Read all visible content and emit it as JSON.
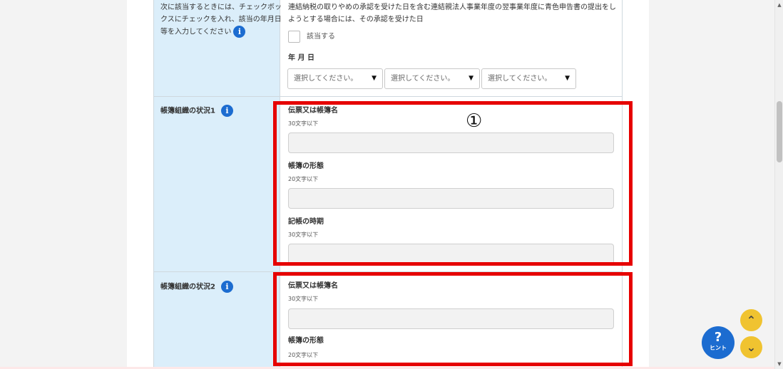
{
  "section_top": {
    "label_text": "次に該当するときには、チェックボックスにチェックを入れ、該当の年月日等を入力してください",
    "label_line1": "次に該当するときには、チェックボッ",
    "label_line2": "クスにチェックを入れ、該当の年月日",
    "label_line3": "等を入力してください",
    "description_line1": "連結納税の取りやめの承認を受けた日を含む連結親法人事業年度の翌事業年度に青色申告書の提出をし",
    "description_line2": "ようとする場合には、その承認を受けた日",
    "checkbox_label": "該当する",
    "date_label": "年 月 日",
    "select_placeholder": "選択してください。"
  },
  "section_1": {
    "label": "帳簿組織の状況1",
    "marker": "①",
    "fields": [
      {
        "label": "伝票又は帳簿名",
        "hint": "30文字以下",
        "value": ""
      },
      {
        "label": "帳簿の形態",
        "hint": "20文字以下",
        "value": ""
      },
      {
        "label": "記帳の時期",
        "hint": "30文字以下",
        "value": ""
      }
    ]
  },
  "section_2": {
    "label": "帳簿組織の状況2",
    "fields": [
      {
        "label": "伝票又は帳簿名",
        "hint": "30文字以下",
        "value": ""
      },
      {
        "label": "帳簿の形態",
        "hint": "20文字以下",
        "value": ""
      }
    ]
  },
  "icons": {
    "info": "i",
    "hint_question": "?",
    "hint_label": "ヒント",
    "scroll_top": "⌅",
    "scroll_bottom": "⌄"
  },
  "colors": {
    "highlight": "#e60000",
    "label_bg": "#dbeefa",
    "info_blue": "#1c6cd0",
    "nav_yellow": "#f0c330"
  }
}
